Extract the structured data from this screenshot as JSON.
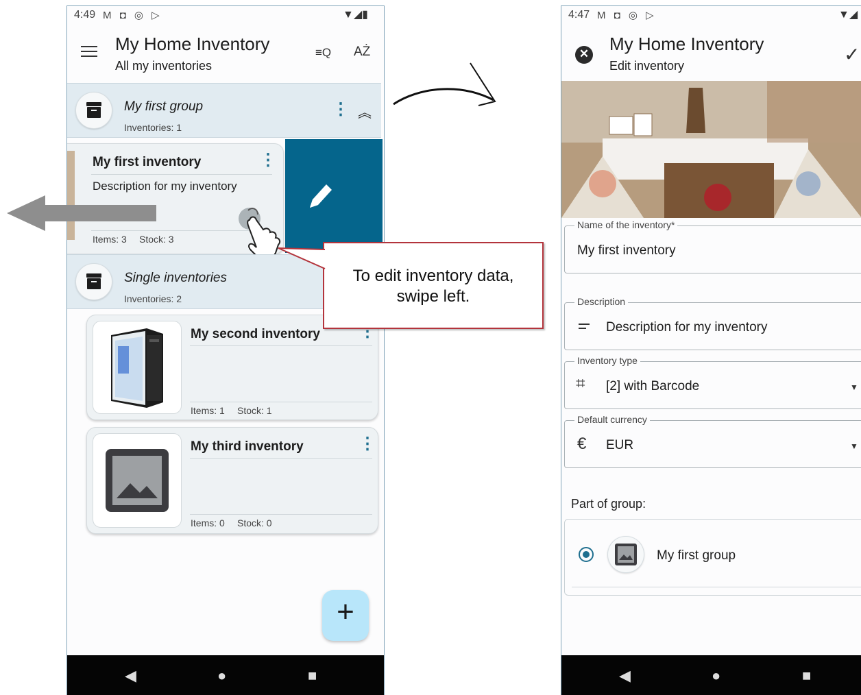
{
  "left": {
    "status": {
      "time": "4:49",
      "icons": "M ◘ ◎ ▷"
    },
    "title": "My Home Inventory",
    "subtitle": "All my inventories",
    "menu_icon": "hamburger-icon",
    "filter_icon": "filter-search-icon",
    "sort_icon": "sort-az-icon",
    "group1": {
      "name": "My first group",
      "count": "Inventories: 1"
    },
    "inventory1": {
      "title": "My first inventory",
      "description": "Description for my inventory",
      "items": "Items: 3",
      "stock": "Stock: 3"
    },
    "group2": {
      "name": "Single inventories",
      "count": "Inventories: 2"
    },
    "inventory2": {
      "title": "My second inventory",
      "items": "Items: 1",
      "stock": "Stock: 1"
    },
    "inventory3": {
      "title": "My third inventory",
      "items": "Items: 0",
      "stock": "Stock: 0"
    },
    "fab": "+"
  },
  "callout": {
    "line1": "To edit inventory data,",
    "line2": "swipe left."
  },
  "right": {
    "status": {
      "time": "4:47",
      "icons": "M ◘ ◎ ▷"
    },
    "title": "My Home Inventory",
    "subtitle": "Edit inventory",
    "fields": {
      "name": {
        "label": "Name of the inventory*",
        "value": "My first inventory"
      },
      "description": {
        "label": "Description",
        "value": "Description for my inventory"
      },
      "type": {
        "label": "Inventory type",
        "value": "[2] with Barcode"
      },
      "currency": {
        "label": "Default currency",
        "value": "EUR",
        "symbol": "€"
      }
    },
    "group_section_label": "Part of group:",
    "group_option": "My first group"
  },
  "colors": {
    "accent": "#1f6f8f",
    "swipe_bg": "#05658c",
    "group_bg": "#e1ebf1",
    "fab_bg": "#b8e6fa",
    "callout_border": "#b3343c"
  }
}
